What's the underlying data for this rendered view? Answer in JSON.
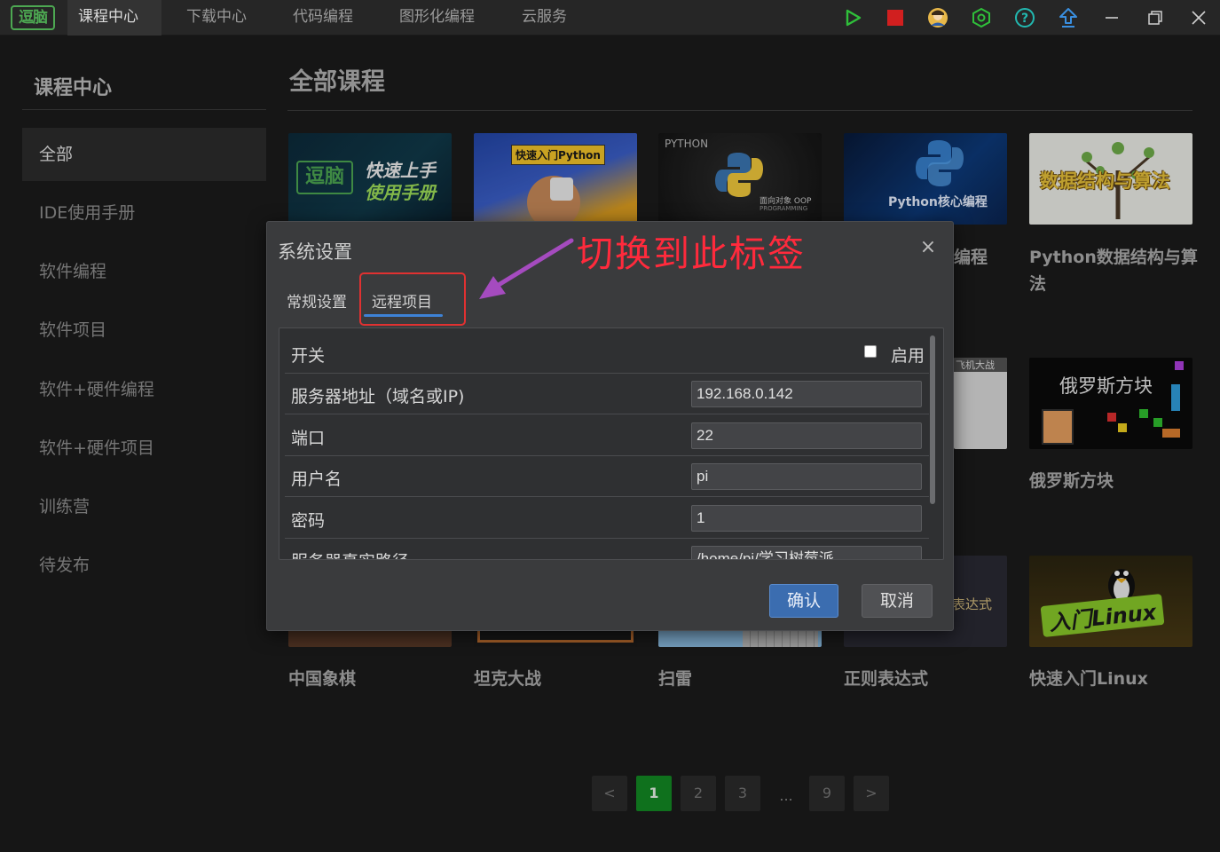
{
  "topbar": {
    "logo": "逗脑",
    "tabs": [
      {
        "label": "课程中心",
        "active": true
      },
      {
        "label": "下载中心",
        "active": false
      },
      {
        "label": "代码编程",
        "active": false
      },
      {
        "label": "图形化编程",
        "active": false
      },
      {
        "label": "云服务",
        "active": false
      }
    ],
    "icons": [
      "play-icon",
      "stop-icon",
      "avatar-icon",
      "hexagon-settings-icon",
      "help-icon",
      "upload-icon",
      "minimize-icon",
      "restore-icon",
      "close-icon"
    ]
  },
  "sidebar": {
    "title": "课程中心",
    "items": [
      {
        "label": "全部",
        "active": true
      },
      {
        "label": "IDE使用手册",
        "active": false
      },
      {
        "label": "软件编程",
        "active": false
      },
      {
        "label": "软件项目",
        "active": false
      },
      {
        "label": "软件+硬件编程",
        "active": false
      },
      {
        "label": "软件+硬件项目",
        "active": false
      },
      {
        "label": "训练营",
        "active": false
      },
      {
        "label": "待发布",
        "active": false
      }
    ]
  },
  "main": {
    "title": "全部课程",
    "thumb_text": {
      "logo": "逗脑",
      "manual_line1": "快速上手",
      "manual_line2": "使用手册",
      "py_badge": "快速入门Python",
      "python_word": "PYTHON",
      "oop": "面向对象 OOP",
      "programming": "PROGRAMMING",
      "python_core": "Python核心编程",
      "ds_algo": "数据结构与算法",
      "tetris": "俄罗斯方块",
      "plane": "飞机大战",
      "regex": "表达式",
      "linux": "入门Linux"
    },
    "row2_titles": [
      {
        "label": "编程"
      },
      {
        "label": "Python数据结构与算法"
      }
    ],
    "row3_titles": [
      {
        "label": "俄罗斯方块"
      }
    ],
    "row4_titles": [
      {
        "label": "中国象棋"
      },
      {
        "label": "坦克大战"
      },
      {
        "label": "扫雷"
      },
      {
        "label": "正则表达式"
      },
      {
        "label": "快速入门Linux"
      }
    ]
  },
  "pagination": {
    "prev": "<",
    "pages": [
      "1",
      "2",
      "3"
    ],
    "dots": "...",
    "last": "9",
    "next": ">",
    "current": "1"
  },
  "dialog": {
    "title": "系统设置",
    "close": "×",
    "tabs": [
      {
        "label": "常规设置",
        "active": false
      },
      {
        "label": "远程项目",
        "active": true
      }
    ],
    "switch_label": "开关",
    "enable_label": "启用",
    "enabled": false,
    "fields": [
      {
        "label": "服务器地址（域名或IP)",
        "value": "192.168.0.142"
      },
      {
        "label": "端口",
        "value": "22"
      },
      {
        "label": "用户名",
        "value": "pi"
      },
      {
        "label": "密码",
        "value": "1"
      },
      {
        "label": "服务器真实路径",
        "value": "/home/pi/学习树莓派"
      }
    ],
    "ok_label": "确认",
    "cancel_label": "取消"
  },
  "annotation": {
    "text": "切换到此标签",
    "color": "#ff2a3c",
    "arrow_color": "#a54bbf"
  },
  "colors": {
    "accent_green": "#138a24",
    "accent_blue": "#3b6db0",
    "highlight_red": "#e03131"
  }
}
